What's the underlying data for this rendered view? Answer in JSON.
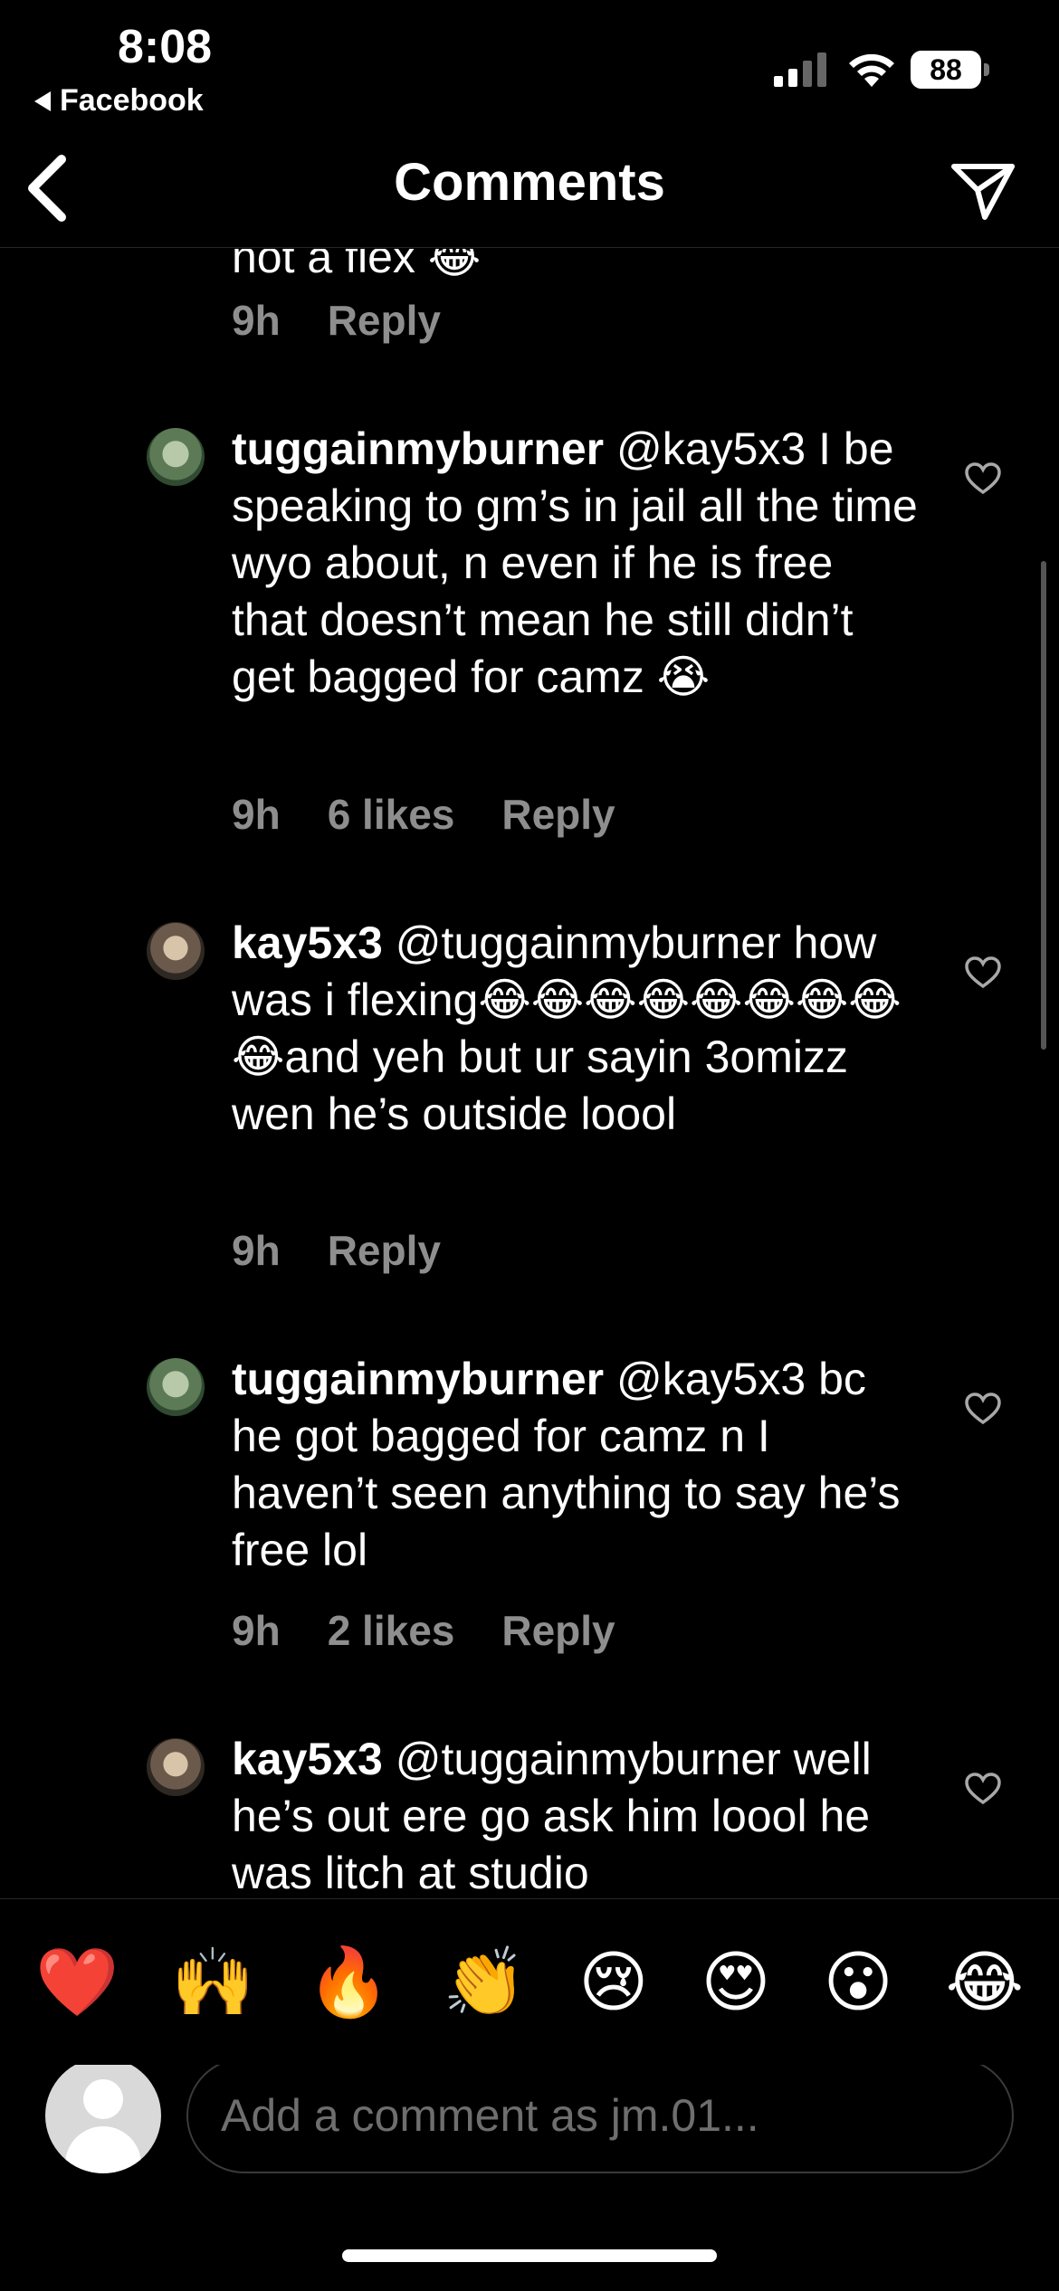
{
  "status_bar": {
    "time": "8:08",
    "back_app": "Facebook",
    "battery": "88"
  },
  "nav": {
    "title": "Comments"
  },
  "partial_comment": {
    "text_fragment": "not a flex 😂",
    "time": "9h",
    "reply": "Reply"
  },
  "comments": [
    {
      "username": "tuggainmyburner",
      "text": " @kay5x3 I be speaking to gm’s in jail all the time wyo about, n even if he is free that doesn’t mean he still didn’t get bagged for camz 😭",
      "time": "9h",
      "likes": "6 likes",
      "reply": "Reply"
    },
    {
      "username": "kay5x3",
      "text": " @tuggainmyburner how was i flexing😂😂😂😂😂😂😂😂😂and yeh but ur sayin 3omizz wen he’s outside loool",
      "time": "9h",
      "reply": "Reply"
    },
    {
      "username": "tuggainmyburner",
      "text": " @kay5x3 bc he got bagged for camz n I haven’t seen anything to say he’s free lol",
      "time": "9h",
      "likes": "2 likes",
      "reply": "Reply"
    },
    {
      "username": "kay5x3",
      "text": " @tuggainmyburner well he’s out ere go ask him loool he was litch at studio"
    }
  ],
  "quick_reactions": [
    "❤️",
    "🙌",
    "🔥",
    "👏",
    "😢",
    "😍",
    "😮",
    "😂"
  ],
  "composer": {
    "placeholder": "Add a comment as jm.01..."
  },
  "icons": {
    "back": "chevron-left-icon",
    "send": "paper-plane-icon",
    "like": "heart-outline-icon"
  }
}
